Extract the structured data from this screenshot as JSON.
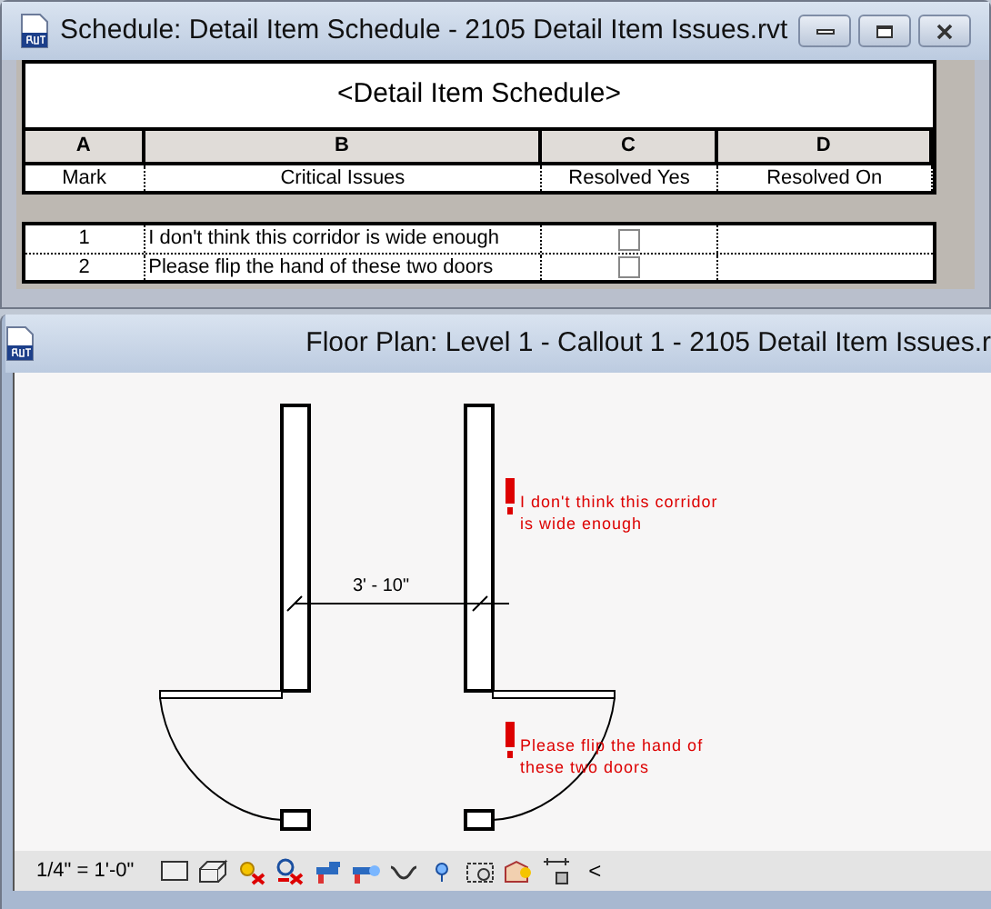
{
  "schedule_window": {
    "title": "Schedule: Detail Item Schedule - 2105 Detail Item Issues.rvt",
    "heading": "<Detail Item Schedule>",
    "column_letters": [
      "A",
      "B",
      "C",
      "D"
    ],
    "columns": [
      "Mark",
      "Critical Issues",
      "Resolved Yes",
      "Resolved On"
    ],
    "rows": [
      {
        "mark": "1",
        "issue": "I don't think this corridor is wide enough",
        "resolved": false
      },
      {
        "mark": "2",
        "issue": "Please flip the hand of these two doors",
        "resolved": false
      }
    ]
  },
  "plan_window": {
    "title": "Floor Plan: Level 1 - Callout 1 - 2105 Detail Item Issues.r",
    "dimension": "3' - 10\"",
    "notes": [
      {
        "lines": [
          "I don't think this corridor",
          "is wide enough"
        ]
      },
      {
        "lines": [
          "Please flip the hand of",
          "these two doors"
        ]
      }
    ]
  },
  "status_bar": {
    "scale": "1/4\" = 1'-0\"",
    "collapse": "<"
  }
}
